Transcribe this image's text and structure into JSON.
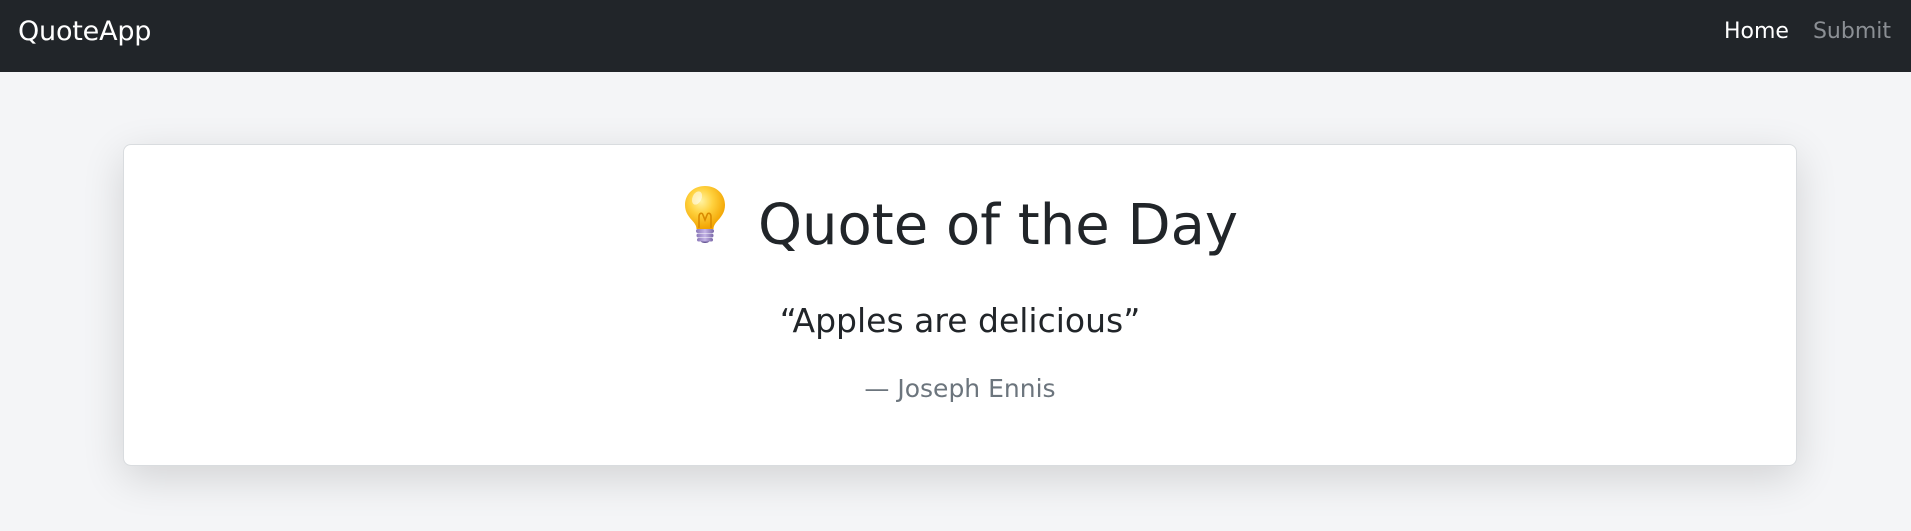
{
  "navbar": {
    "brand": "QuoteApp",
    "links": [
      {
        "label": "Home",
        "active": true
      },
      {
        "label": "Submit",
        "active": false
      }
    ]
  },
  "main": {
    "icon": "lightbulb-icon",
    "title": "Quote of the Day",
    "quote_text": "“Apples are delicious”",
    "author_line": "— Joseph Ennis"
  },
  "colors": {
    "navbar_bg": "#212529",
    "page_bg": "#f4f5f7",
    "card_bg": "#ffffff",
    "muted_text": "#6c757d"
  }
}
